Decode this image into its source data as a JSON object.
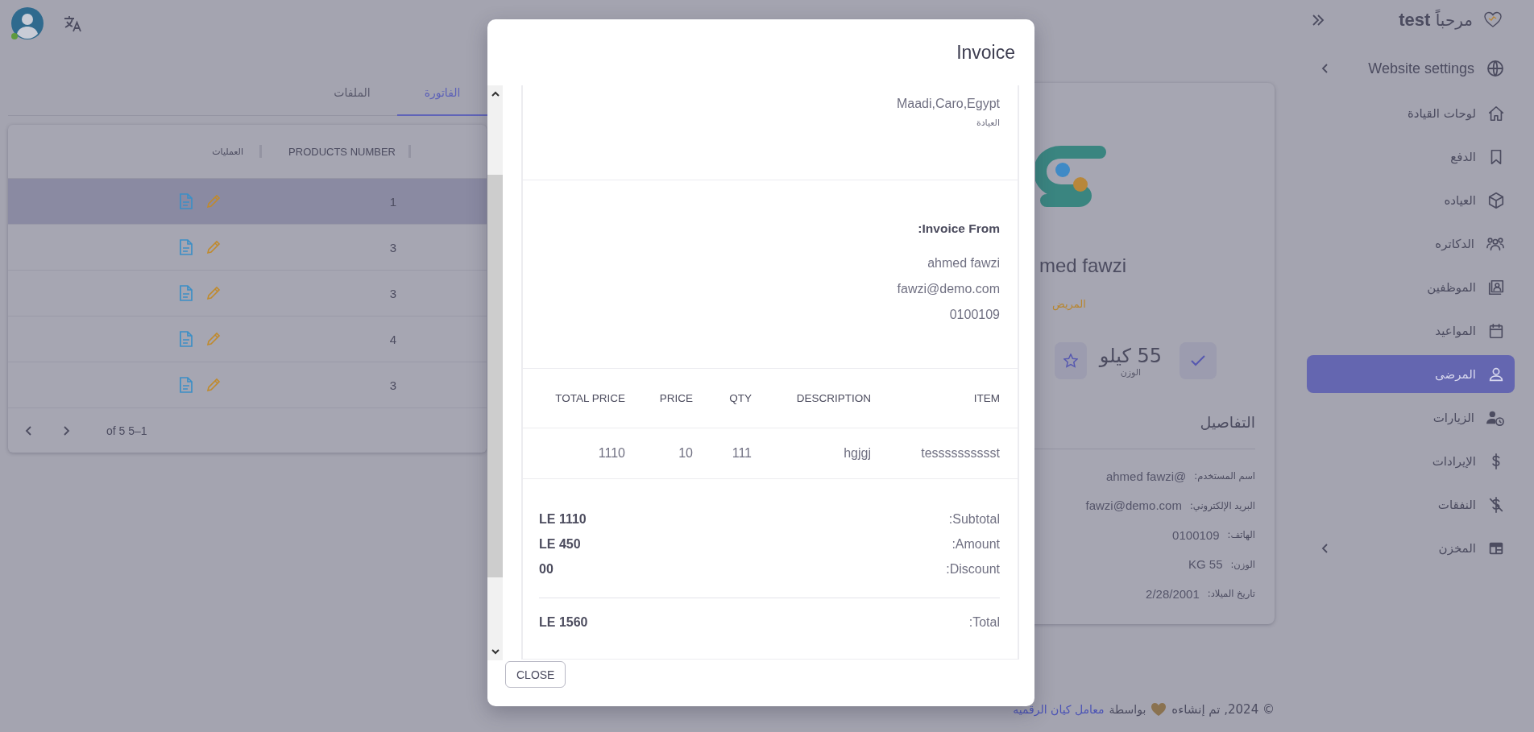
{
  "sidebar": {
    "greeting": "مرحباً",
    "user": "test",
    "settings": {
      "label": "Website settings",
      "expanded": false
    },
    "items": [
      {
        "label": "لوحات القيادة",
        "selected": false,
        "has_children": false
      },
      {
        "label": "الدفع",
        "selected": false,
        "has_children": false
      },
      {
        "label": "العياده",
        "selected": false,
        "has_children": false
      },
      {
        "label": "الدكاتره",
        "selected": false,
        "has_children": false
      },
      {
        "label": "الموظفين",
        "selected": false,
        "has_children": false
      },
      {
        "label": "المواعيد",
        "selected": false,
        "has_children": false
      },
      {
        "label": "المرضى",
        "selected": true,
        "has_children": false
      },
      {
        "label": "الزيارات",
        "selected": false,
        "has_children": false
      },
      {
        "label": "الإيرادات",
        "selected": false,
        "has_children": false
      },
      {
        "label": "النفقات",
        "selected": false,
        "has_children": false
      },
      {
        "label": "المخزن",
        "selected": false,
        "has_children": true
      }
    ]
  },
  "tabs": [
    {
      "label": "الفاتورة",
      "selected": true
    },
    {
      "label": "الملفات",
      "selected": false
    }
  ],
  "table": {
    "columns": [
      "PRODUCTS NUMBER",
      "العمليات"
    ],
    "rows": [
      {
        "products_number": "1",
        "selected": true
      },
      {
        "products_number": "3",
        "selected": false
      },
      {
        "products_number": "3",
        "selected": false
      },
      {
        "products_number": "4",
        "selected": false
      },
      {
        "products_number": "3",
        "selected": false
      }
    ],
    "pagination": "of 5 5–1"
  },
  "profile": {
    "name": "med fawzi",
    "role": "المريض",
    "stat": {
      "value": "55 كيلو",
      "label": "الوزن"
    },
    "details_title": "التفاصيل",
    "details": [
      {
        "label": "اسم المستخدم:",
        "value": "ahmed fawzi@"
      },
      {
        "label": "البريد الإلكتروني:",
        "value": "fawzi@demo.com"
      },
      {
        "label": "الهاتف:",
        "value": "0100109"
      },
      {
        "label": "الوزن:",
        "value": "KG 55"
      },
      {
        "label": "تاريخ الميلاد:",
        "value": "2/28/2001"
      }
    ]
  },
  "footer": {
    "text": "© 2024, تم إنشاءه",
    "by": "بواسطة",
    "link": "معامل كيان الرقميه"
  },
  "modal": {
    "title": "Invoice",
    "address": "Maadi,Caro,Egypt",
    "clinic": "العيادة",
    "from": {
      "heading": ":Invoice From",
      "name": "ahmed fawzi",
      "email": "fawzi@demo.com",
      "phone": "0100109"
    },
    "columns": [
      "ITEM",
      "DESCRIPTION",
      "QTY",
      "PRICE",
      "TOTAL PRICE"
    ],
    "rows": [
      [
        "tesssssssssst",
        "hgjgj",
        "111",
        "10",
        "1110"
      ]
    ],
    "summary": [
      {
        "label": ":Subtotal",
        "value": "LE 1110"
      },
      {
        "label": ":Amount",
        "value": "LE 450"
      },
      {
        "label": ":Discount",
        "value": "00"
      }
    ],
    "total": {
      "label": ":Total",
      "value": "LE 1560"
    },
    "close": "CLOSE"
  }
}
